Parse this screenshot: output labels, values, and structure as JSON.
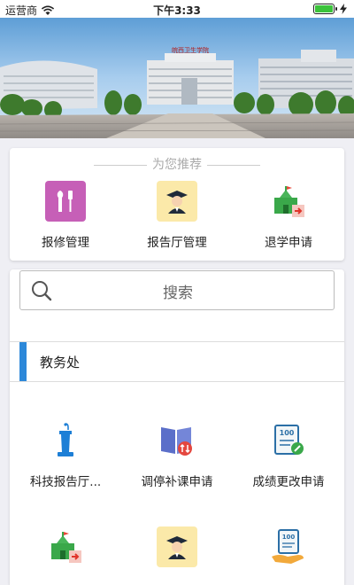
{
  "status_bar": {
    "carrier": "运营商",
    "time": "下午3:33"
  },
  "banner": {
    "sign_text": "皖西卫生学院"
  },
  "recommend": {
    "title": "为您推荐",
    "items": [
      {
        "label": "报修管理",
        "icon": "wrench-screwdriver-icon"
      },
      {
        "label": "报告厅管理",
        "icon": "graduate-avatar-icon"
      },
      {
        "label": "退学申请",
        "icon": "school-exit-icon"
      }
    ]
  },
  "search": {
    "placeholder": "搜索"
  },
  "section": {
    "title": "教务处"
  },
  "services": [
    {
      "label": "科技报告厅...",
      "icon": "podium-microphone-icon"
    },
    {
      "label": "调停补课申请",
      "icon": "book-swap-icon"
    },
    {
      "label": "成绩更改申请",
      "icon": "score-edit-icon"
    },
    {
      "label": "",
      "icon": "school-exit-icon"
    },
    {
      "label": "",
      "icon": "graduate-avatar-icon"
    },
    {
      "label": "",
      "icon": "score-hand-icon"
    }
  ],
  "colors": {
    "accent": "#2c88d9",
    "battery": "#3bc33b",
    "repair_icon_bg": "#c65fb7",
    "graduate_icon_bg": "#fbe9a9"
  }
}
